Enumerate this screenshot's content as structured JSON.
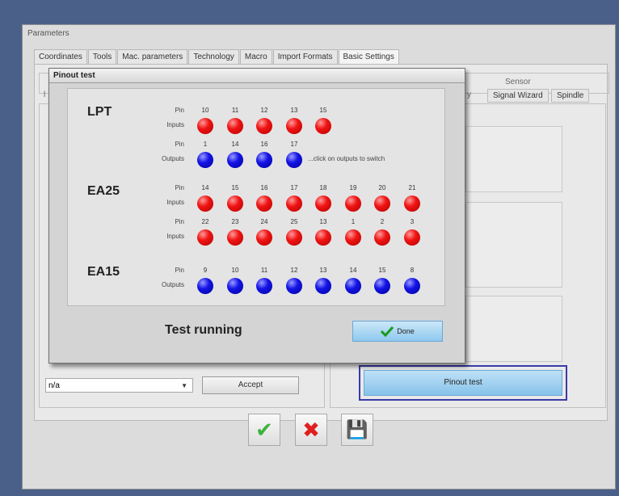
{
  "window": {
    "title": "Parameters"
  },
  "tabs": [
    "Coordinates",
    "Tools",
    "Mac. parameters",
    "Technology",
    "Macro",
    "Import Formats",
    "Basic Settings"
  ],
  "sensor_label": "Sensor",
  "sub_tabs": {
    "signal_wizard": "Signal Wizard",
    "spindle": "Spindle"
  },
  "combo": {
    "value": "n/a",
    "arrow": "▼"
  },
  "accept_label": "Accept",
  "pinout_button_label": "Pinout test",
  "dialog": {
    "title": "Pinout test",
    "pin_label": "Pin",
    "inputs_label": "Inputs",
    "outputs_label": "Outputs",
    "groups": {
      "lpt": {
        "name": "LPT",
        "inputs_pins": [
          "10",
          "11",
          "12",
          "13",
          "15"
        ],
        "outputs_pins": [
          "1",
          "14",
          "16",
          "17"
        ]
      },
      "ea25": {
        "name": "EA25",
        "row1_pins": [
          "14",
          "15",
          "16",
          "17",
          "18",
          "19",
          "20",
          "21"
        ],
        "row2_pins": [
          "22",
          "23",
          "24",
          "25",
          "13",
          "1",
          "2",
          "3"
        ]
      },
      "ea15": {
        "name": "EA15",
        "outputs_pins": [
          "9",
          "10",
          "11",
          "12",
          "13",
          "14",
          "15",
          "8"
        ]
      }
    },
    "hint": "...click on outputs to switch",
    "status": "Test running",
    "done_label": "Done",
    "led_colors": {
      "input": "#e01010",
      "output": "#1010dd"
    }
  },
  "bottom": {
    "ok": "✔",
    "cancel": "✖",
    "save": "💾"
  }
}
